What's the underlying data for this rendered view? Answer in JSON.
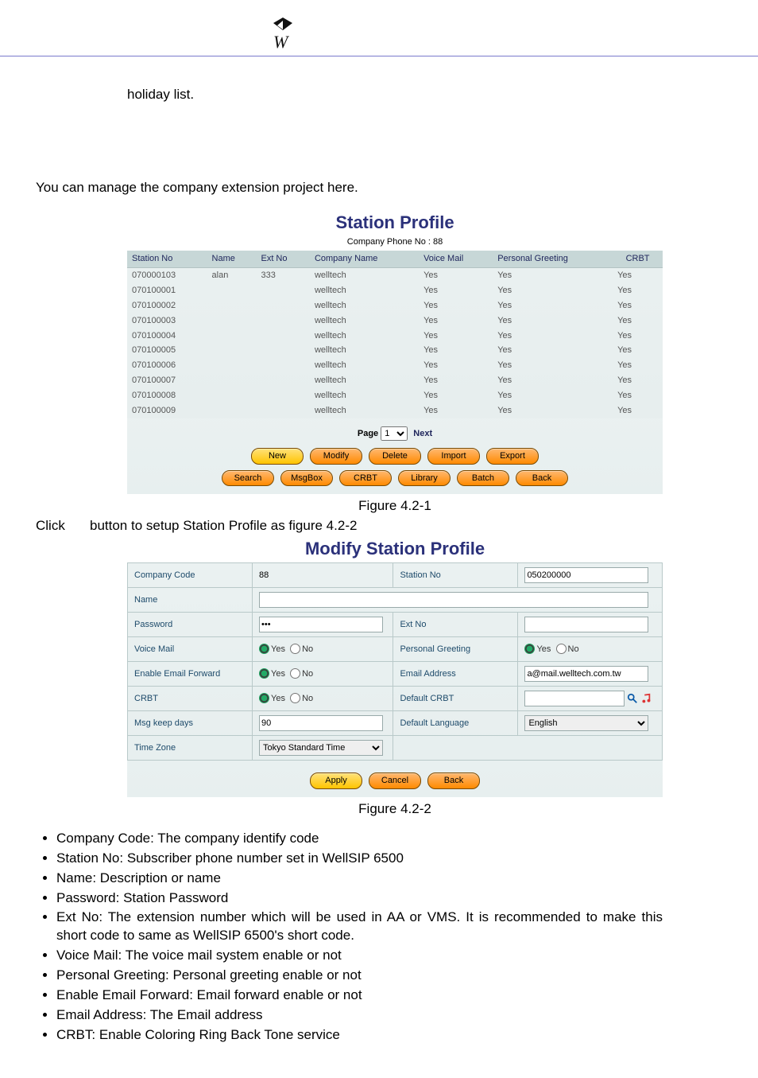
{
  "header_logo_text": "W",
  "doc": {
    "holiday_line": "holiday list.",
    "intro": "You can manage the company extension project here.",
    "fig1": "Figure 4.2-1",
    "click_word": "Click",
    "click_rest": "button to setup Station Profile as figure 4.2-2",
    "fig2": "Figure 4.2-2"
  },
  "station_profile": {
    "title": "Station Profile",
    "subtitle": "Company Phone No : 88",
    "cols": [
      "Station No",
      "Name",
      "Ext No",
      "Company Name",
      "Voice Mail",
      "Personal Greeting",
      "CRBT"
    ],
    "rows": [
      {
        "sn": "070000103",
        "name": "alan",
        "ext": "333",
        "cn": "welltech",
        "vm": "Yes",
        "pg": "Yes",
        "cr": "Yes"
      },
      {
        "sn": "070100001",
        "name": "",
        "ext": "",
        "cn": "welltech",
        "vm": "Yes",
        "pg": "Yes",
        "cr": "Yes"
      },
      {
        "sn": "070100002",
        "name": "",
        "ext": "",
        "cn": "welltech",
        "vm": "Yes",
        "pg": "Yes",
        "cr": "Yes"
      },
      {
        "sn": "070100003",
        "name": "",
        "ext": "",
        "cn": "welltech",
        "vm": "Yes",
        "pg": "Yes",
        "cr": "Yes"
      },
      {
        "sn": "070100004",
        "name": "",
        "ext": "",
        "cn": "welltech",
        "vm": "Yes",
        "pg": "Yes",
        "cr": "Yes"
      },
      {
        "sn": "070100005",
        "name": "",
        "ext": "",
        "cn": "welltech",
        "vm": "Yes",
        "pg": "Yes",
        "cr": "Yes"
      },
      {
        "sn": "070100006",
        "name": "",
        "ext": "",
        "cn": "welltech",
        "vm": "Yes",
        "pg": "Yes",
        "cr": "Yes"
      },
      {
        "sn": "070100007",
        "name": "",
        "ext": "",
        "cn": "welltech",
        "vm": "Yes",
        "pg": "Yes",
        "cr": "Yes"
      },
      {
        "sn": "070100008",
        "name": "",
        "ext": "",
        "cn": "welltech",
        "vm": "Yes",
        "pg": "Yes",
        "cr": "Yes"
      },
      {
        "sn": "070100009",
        "name": "",
        "ext": "",
        "cn": "welltech",
        "vm": "Yes",
        "pg": "Yes",
        "cr": "Yes"
      }
    ],
    "pager": {
      "label_page": "Page",
      "selected": "1",
      "next": "Next"
    },
    "buttons_row1": [
      {
        "id": "new",
        "label": "New",
        "color": "yellow"
      },
      {
        "id": "modify",
        "label": "Modify",
        "color": "orange"
      },
      {
        "id": "delete",
        "label": "Delete",
        "color": "orange"
      },
      {
        "id": "import",
        "label": "Import",
        "color": "orange"
      },
      {
        "id": "export",
        "label": "Export",
        "color": "orange"
      }
    ],
    "buttons_row2": [
      {
        "id": "search",
        "label": "Search",
        "color": "orange"
      },
      {
        "id": "msgbox",
        "label": "MsgBox",
        "color": "orange"
      },
      {
        "id": "crbt",
        "label": "CRBT",
        "color": "orange"
      },
      {
        "id": "library",
        "label": "Library",
        "color": "orange"
      },
      {
        "id": "batch",
        "label": "Batch",
        "color": "orange"
      },
      {
        "id": "back",
        "label": "Back",
        "color": "orange"
      }
    ]
  },
  "modify": {
    "title": "Modify Station Profile",
    "rows": [
      {
        "l1": "Company Code",
        "v1": "88",
        "l2": "Station No",
        "v2": "050200000",
        "t1": "text_ro",
        "t2": "text"
      },
      {
        "l1": "Name",
        "v1": "",
        "l2": "",
        "v2": "",
        "t1": "text_full"
      },
      {
        "l1": "Password",
        "v1": "•••",
        "l2": "Ext No",
        "v2": "",
        "t1": "password",
        "t2": "text"
      },
      {
        "l1": "Voice Mail",
        "v1": "yesno",
        "l2": "Personal Greeting",
        "v2": "yesno",
        "t1": "radio",
        "t2": "radio"
      },
      {
        "l1": "Enable Email Forward",
        "v1": "yesno",
        "l2": "Email Address",
        "v2": "a@mail.welltech.com.tw",
        "t1": "radio",
        "t2": "text"
      },
      {
        "l1": "CRBT",
        "v1": "yesno",
        "l2": "Default CRBT",
        "v2": "",
        "t1": "radio",
        "t2": "text_icons"
      },
      {
        "l1": "Msg keep days",
        "v1": "90",
        "l2": "Default Language",
        "v2": "English",
        "t1": "text",
        "t2": "select"
      },
      {
        "l1": "Time Zone",
        "v1": "Tokyo Standard Time",
        "l2": "",
        "v2": "",
        "t1": "select_half"
      }
    ],
    "buttons": [
      {
        "id": "apply",
        "label": "Apply",
        "color": "yellow"
      },
      {
        "id": "cancel",
        "label": "Cancel",
        "color": "orange"
      },
      {
        "id": "back",
        "label": "Back",
        "color": "orange"
      }
    ],
    "radio": {
      "yes": "Yes",
      "no": "No"
    }
  },
  "field_list": [
    "Company Code: The company identify code",
    "Station No: Subscriber phone number set in WellSIP 6500",
    "Name: Description or name",
    "Password: Station Password",
    "Ext No: The extension number which will be used in AA or VMS. It is recommended to make this short code to same as WellSIP 6500's short code.",
    "Voice Mail: The voice mail system enable or not",
    "Personal Greeting: Personal greeting enable or not",
    "Enable Email Forward: Email forward enable or not",
    "Email Address: The Email address",
    "CRBT: Enable Coloring Ring Back Tone service"
  ]
}
